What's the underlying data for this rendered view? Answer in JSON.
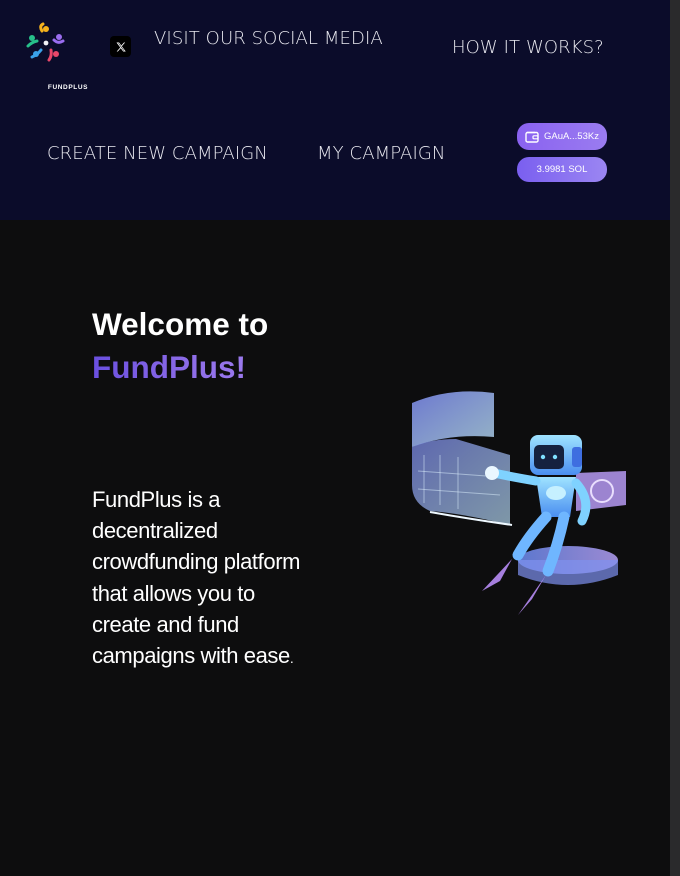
{
  "brand": {
    "logo_text": "FUNDPLUS"
  },
  "header": {
    "social_label": "VISIT OUR SOCIAL MEDIA",
    "how_label": "HOW IT WORKS?",
    "create_label": "CREATE NEW CAMPAIGN",
    "my_campaign_label": "MY CAMPAIGN",
    "wallet_address": "GAuA...53Kz",
    "balance": "3.9981 SOL",
    "icons": {
      "social": "x-twitter-icon",
      "wallet": "wallet-icon"
    }
  },
  "hero": {
    "title_line1": "Welcome to",
    "title_line2": "FundPlus!",
    "description": "FundPlus is a decentralized crowdfunding platform that allows you to create and fund campaigns with ease",
    "description_end": "."
  },
  "colors": {
    "header_bg": "#0b0c2a",
    "page_bg": "#0d0d0e",
    "accent": "#8a62f0",
    "brand_gradient_start": "#6a4fe0",
    "brand_gradient_end": "#a07ff0"
  }
}
